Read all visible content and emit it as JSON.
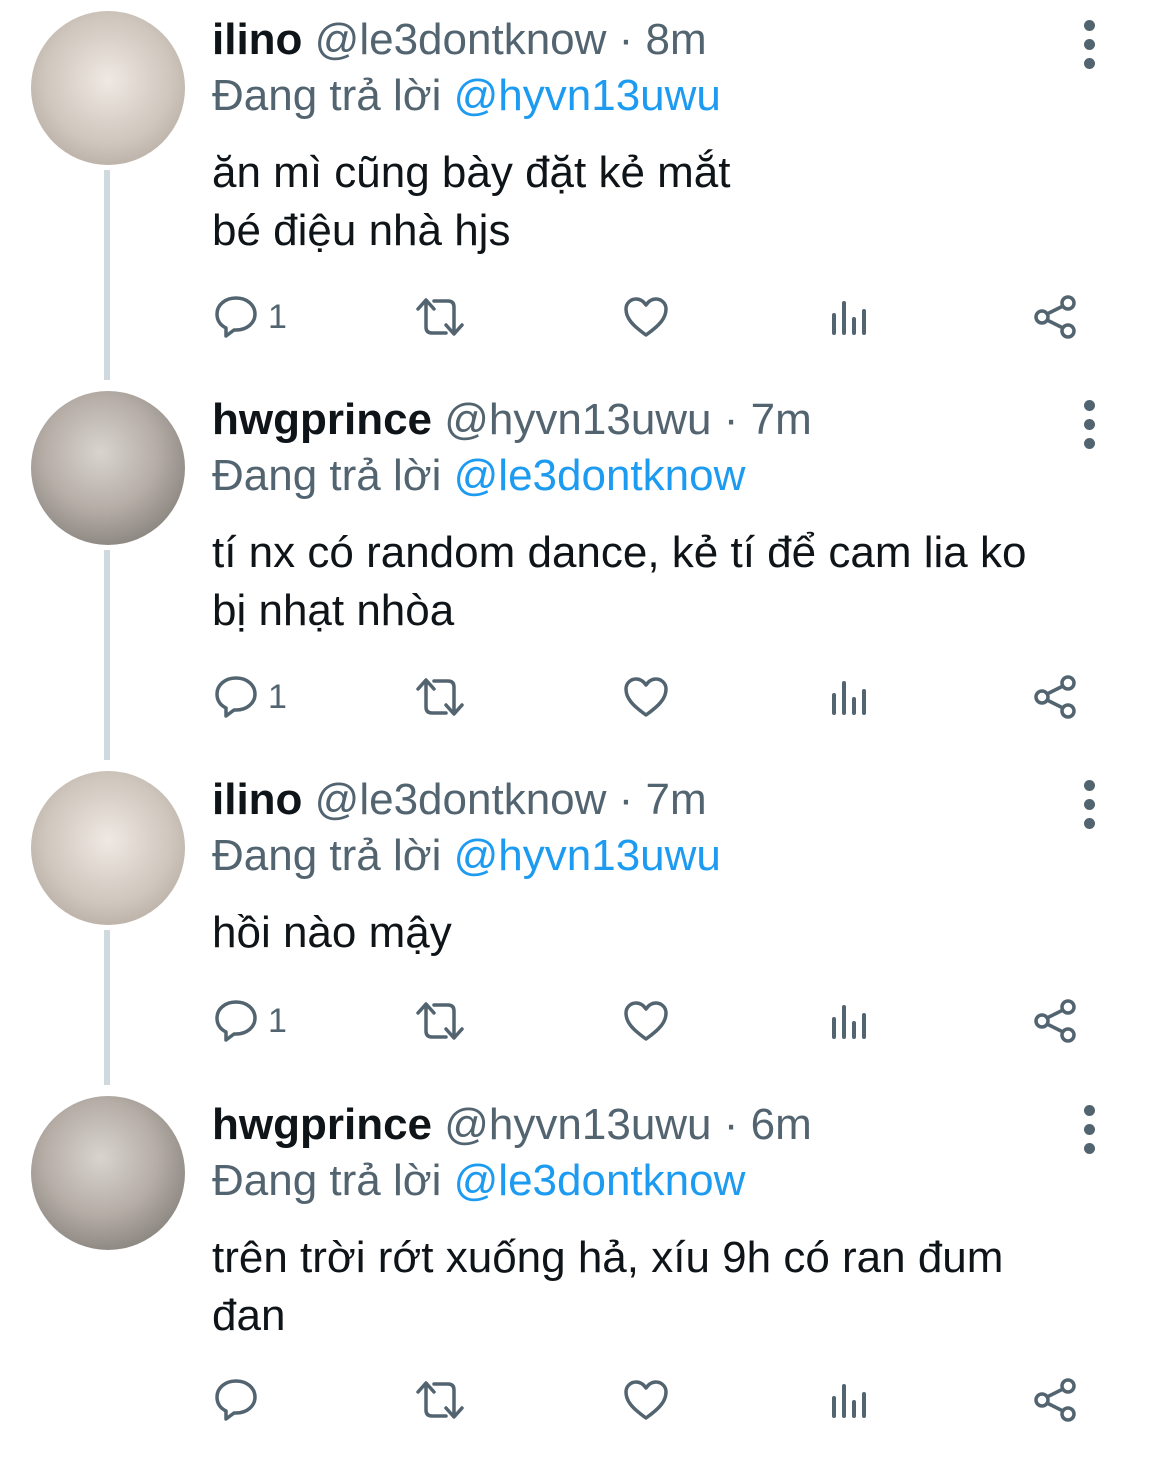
{
  "tweets": [
    {
      "name": "ilino",
      "handle": "@le3dontknow",
      "separator": "·",
      "time": "8m",
      "reply_prefix": "Đang trả lời",
      "reply_to": "@hyvn13uwu",
      "text_lines": [
        "ăn mì cũng bày đặt kẻ mắt",
        "bé điệu nhà hjs"
      ],
      "reply_count": "1"
    },
    {
      "name": "hwgprince",
      "handle": "@hyvn13uwu",
      "separator": "·",
      "time": "7m",
      "reply_prefix": "Đang trả lời",
      "reply_to": "@le3dontknow",
      "text_lines": [
        "tí nx có random dance, kẻ tí để cam lia ko",
        "bị nhạt nhòa"
      ],
      "reply_count": "1"
    },
    {
      "name": "ilino",
      "handle": "@le3dontknow",
      "separator": "·",
      "time": "7m",
      "reply_prefix": "Đang trả lời",
      "reply_to": "@hyvn13uwu",
      "text_lines": [
        "hồi nào mậy"
      ],
      "reply_count": "1"
    },
    {
      "name": "hwgprince",
      "handle": "@hyvn13uwu",
      "separator": "·",
      "time": "6m",
      "reply_prefix": "Đang trả lời",
      "reply_to": "@le3dontknow",
      "text_lines": [
        "trên trời rớt xuống hả, xíu 9h có ran đum",
        "đan"
      ],
      "reply_count": ""
    }
  ],
  "icons": {
    "reply": "reply-icon",
    "retweet": "retweet-icon",
    "like": "heart-icon",
    "views": "analytics-icon",
    "share": "share-icon",
    "more": "more-vertical-icon"
  },
  "colors": {
    "text": "#0f1419",
    "secondary": "#536471",
    "accent": "#1d9bf0",
    "thread_line": "#cfd9de"
  }
}
